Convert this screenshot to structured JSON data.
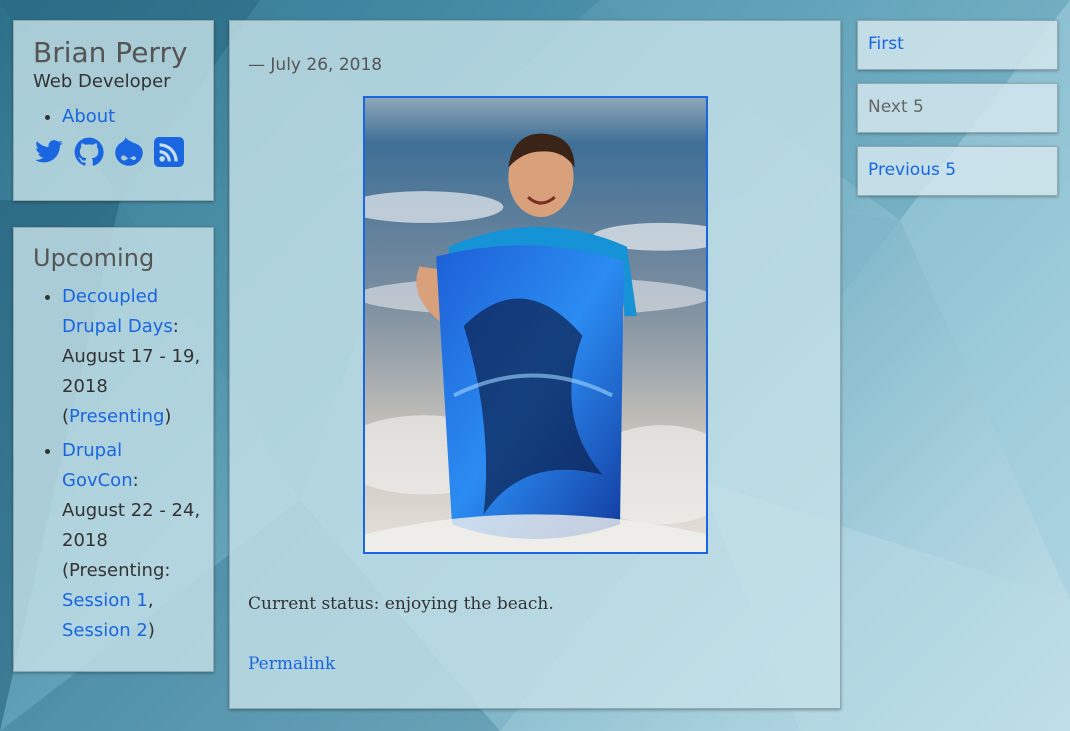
{
  "profile": {
    "name": "Brian Perry",
    "subtitle": "Web Developer",
    "nav": [
      {
        "label": "About"
      }
    ],
    "social_icons": [
      "twitter-icon",
      "github-icon",
      "drupal-icon",
      "rss-icon"
    ]
  },
  "upcoming": {
    "title": "Upcoming",
    "events": [
      {
        "name": "Decoupled Drupal Days",
        "date": ": August 17 - 19, 2018 (",
        "presenting": "Presenting",
        "close": ")"
      },
      {
        "name": "Drupal GovCon",
        "date": ": August 22 - 24, 2018 (Presenting: ",
        "session1": "Session 1",
        "sep": ", ",
        "session2": "Session 2",
        "close": ")"
      }
    ]
  },
  "post": {
    "date": "— July 26, 2018",
    "body": "Current status: enjoying the beach.",
    "permalink": "Permalink"
  },
  "pager": {
    "first": "First",
    "next": "Next 5",
    "previous": "Previous 5"
  },
  "colors": {
    "link": "#1a66e0",
    "panel": "#c5e0e8",
    "background": "#4f93ab"
  }
}
